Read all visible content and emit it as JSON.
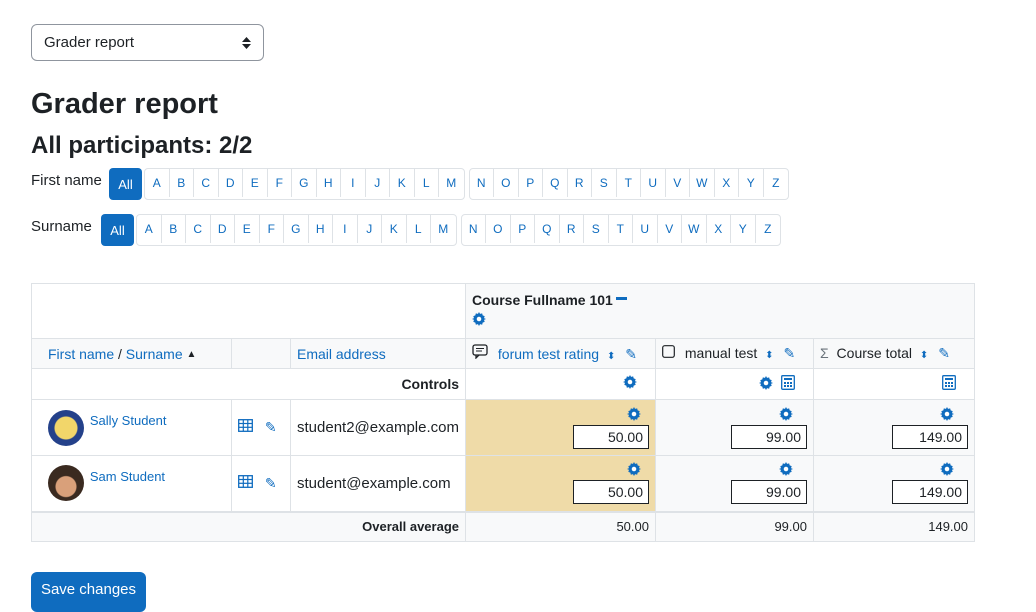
{
  "report_selector": {
    "value": "Grader report"
  },
  "heading": "Grader report",
  "participants": "All participants: 2/2",
  "initials_bar": {
    "first_name_label": "First name",
    "surname_label": "Surname",
    "all_label": "All",
    "letters_1": [
      "A",
      "B",
      "C",
      "D",
      "E",
      "F",
      "G",
      "H",
      "I",
      "J",
      "K",
      "L",
      "M"
    ],
    "letters_2": [
      "N",
      "O",
      "P",
      "Q",
      "R",
      "S",
      "T",
      "U",
      "V",
      "W",
      "X",
      "Y",
      "Z"
    ]
  },
  "table": {
    "course_name": "Course Fullname 101",
    "col_first_name": "First name",
    "col_sep": " / ",
    "col_surname": "Surname",
    "col_email": "Email address",
    "items": [
      {
        "label": "forum test rating"
      },
      {
        "label": "manual test"
      },
      {
        "label": "Course total"
      }
    ],
    "controls_label": "Controls",
    "students": [
      {
        "name": "Sally Student",
        "email": "student2@example.com",
        "grades": [
          "50.00",
          "99.00",
          "149.00"
        ]
      },
      {
        "name": "Sam Student",
        "email": "student@example.com",
        "grades": [
          "50.00",
          "99.00",
          "149.00"
        ]
      }
    ],
    "average_label": "Overall average",
    "averages": [
      "50.00",
      "99.00",
      "149.00"
    ]
  },
  "save_label": "Save changes",
  "colors": {
    "primary": "#0f6cbf",
    "highlight": "#efdba8",
    "header_bg": "#f8f9fa"
  }
}
